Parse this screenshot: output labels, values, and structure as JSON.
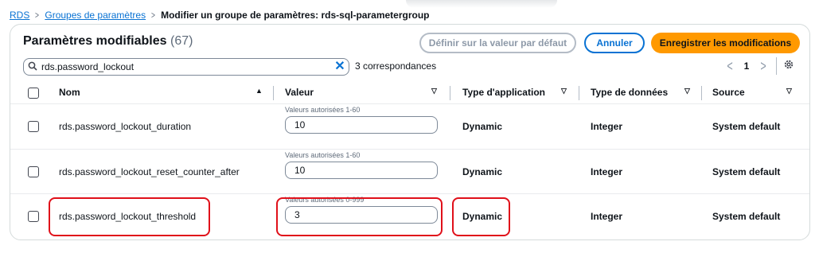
{
  "breadcrumb": {
    "items": [
      "RDS",
      "Groupes de paramètres"
    ],
    "current": "Modifier un groupe de paramètres: rds-sql-parametergroup"
  },
  "header": {
    "title": "Paramètres modifiables",
    "count": "(67)",
    "default_button": "Définir sur la valeur par défaut",
    "cancel_button": "Annuler",
    "save_button": "Enregistrer les modifications"
  },
  "search": {
    "value": "rds.password_lockout",
    "matches": "3 correspondances"
  },
  "pagination": {
    "page": "1"
  },
  "columns": [
    "Nom",
    "Valeur",
    "Type d'application",
    "Type de données",
    "Source"
  ],
  "rows": [
    {
      "name": "rds.password_lockout_duration",
      "hint": "Valeurs autorisées 1-60",
      "value": "10",
      "apply_type": "Dynamic",
      "data_type": "Integer",
      "source": "System default"
    },
    {
      "name": "rds.password_lockout_reset_counter_after",
      "hint": "Valeurs autorisées 1-60",
      "value": "10",
      "apply_type": "Dynamic",
      "data_type": "Integer",
      "source": "System default"
    },
    {
      "name": "rds.password_lockout_threshold",
      "hint": "Valeurs autorisées 0-999",
      "value": "3",
      "apply_type": "Dynamic",
      "data_type": "Integer",
      "source": "System default"
    }
  ],
  "colors": {
    "link": "#0972d3",
    "primary_button": "#ff9900",
    "highlight": "#e0101a"
  },
  "icons": [
    "search-icon",
    "clear-icon",
    "chevron-left-icon",
    "chevron-right-icon",
    "gear-icon",
    "sort-ascending-icon",
    "sort-icon"
  ]
}
